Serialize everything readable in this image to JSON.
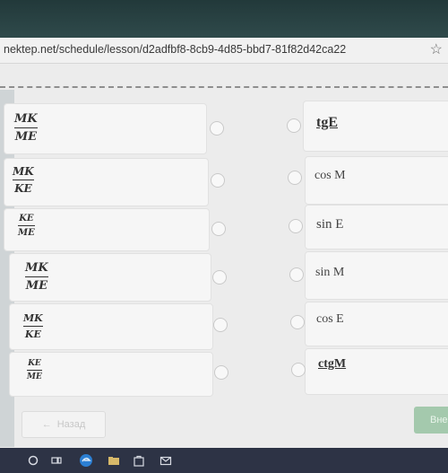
{
  "browser": {
    "url": "nektep.net/schedule/lesson/d2adfbf8-8cb9-4d85-bbd7-81f82d42ca22",
    "star": "☆"
  },
  "left_items": [
    {
      "num": "MK",
      "den": "ME"
    },
    {
      "num": "MK",
      "den": "KE"
    },
    {
      "num": "KE",
      "den": "ME"
    },
    {
      "num": "MK",
      "den": "ME"
    },
    {
      "num": "MK",
      "den": "KE"
    },
    {
      "num": "KE",
      "den": "ME"
    }
  ],
  "right_items": [
    "tgE",
    "cos M",
    "sin E",
    "sin M",
    "cos E",
    "ctgM"
  ],
  "nav": {
    "back_label": "Назад",
    "back_arrow": "←",
    "next_label": "Вне"
  },
  "taskbar_icons": [
    "search-icon",
    "task-view-icon",
    "edge-icon",
    "file-explorer-icon",
    "store-icon",
    "mail-icon"
  ]
}
